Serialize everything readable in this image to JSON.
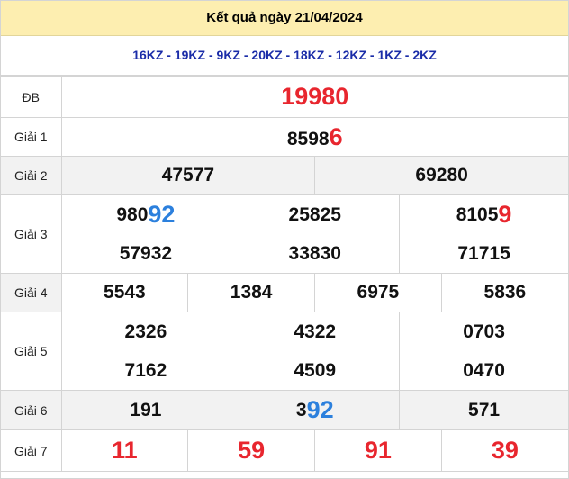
{
  "title": "Kết quả ngày 21/04/2024",
  "codes": "16KZ - 19KZ - 9KZ - 20KZ - 18KZ - 12KZ - 1KZ - 2KZ",
  "labels": {
    "db": "ĐB",
    "g1": "Giải 1",
    "g2": "Giải 2",
    "g3": "Giải 3",
    "g4": "Giải 4",
    "g5": "Giải 5",
    "g6": "Giải 6",
    "g7": "Giải 7"
  },
  "prizes": {
    "db": "19980",
    "g1": {
      "main": "8598",
      "tail": "6"
    },
    "g2": [
      "47577",
      "69280"
    ],
    "g3": [
      {
        "main": "980",
        "tail": "92",
        "tail_color": "blue"
      },
      {
        "main": "25825",
        "tail": ""
      },
      {
        "main": "8105",
        "tail": "9",
        "tail_color": "red"
      },
      {
        "main": "57932",
        "tail": ""
      },
      {
        "main": "33830",
        "tail": ""
      },
      {
        "main": "71715",
        "tail": ""
      }
    ],
    "g4": [
      "5543",
      "1384",
      "6975",
      "5836"
    ],
    "g5": [
      "2326",
      "4322",
      "0703",
      "7162",
      "4509",
      "0470"
    ],
    "g6": [
      {
        "main": "191",
        "tail": ""
      },
      {
        "main": "3",
        "tail": "92",
        "tail_color": "blue"
      },
      {
        "main": "571",
        "tail": ""
      }
    ],
    "g7": [
      "11",
      "59",
      "91",
      "39"
    ]
  },
  "colors": {
    "header_bg": "#fdeeb0",
    "codes_text": "#1a2ca8",
    "highlight_red": "#e8262e",
    "highlight_blue": "#2c80dd",
    "row_alt": "#f2f2f2"
  }
}
